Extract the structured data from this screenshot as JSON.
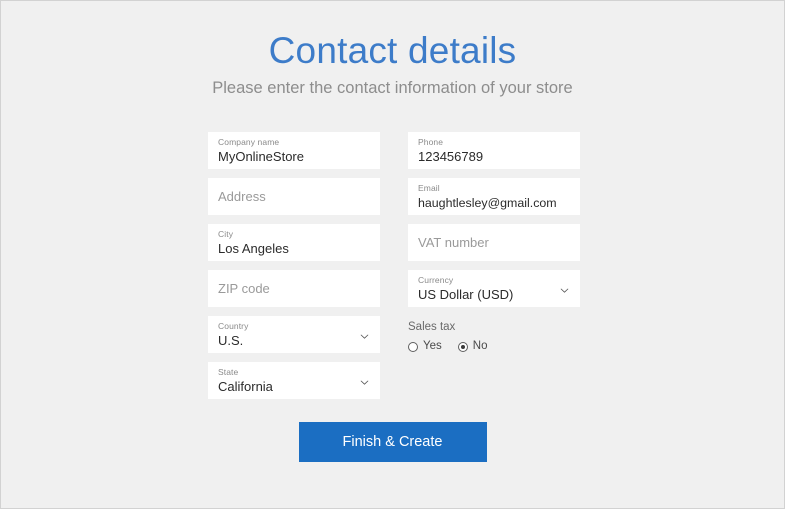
{
  "header": {
    "title": "Contact details",
    "subtitle": "Please enter the contact information of your store",
    "title_color": "#3d7cc9",
    "subtitle_color": "#8d8d8d"
  },
  "form": {
    "left_column": [
      {
        "name": "company-name",
        "label": "Company name",
        "value": "MyOnlineStore",
        "placeholder": "Company name",
        "state": "filled",
        "type": "text"
      },
      {
        "name": "address",
        "label": "Address",
        "value": "",
        "placeholder": "Address",
        "state": "empty",
        "type": "text"
      },
      {
        "name": "city",
        "label": "City",
        "value": "Los Angeles",
        "placeholder": "City",
        "state": "filled",
        "type": "text"
      },
      {
        "name": "zip-code",
        "label": "ZIP code",
        "value": "",
        "placeholder": "ZIP code",
        "state": "empty",
        "type": "text"
      },
      {
        "name": "country",
        "label": "Country",
        "value": "U.S.",
        "placeholder": "Country",
        "state": "filled",
        "type": "select"
      },
      {
        "name": "state",
        "label": "State",
        "value": "California",
        "placeholder": "State",
        "state": "filled",
        "type": "select"
      }
    ],
    "right_column": [
      {
        "name": "phone",
        "label": "Phone",
        "value": "123456789",
        "placeholder": "Phone",
        "state": "filled",
        "type": "text"
      },
      {
        "name": "email",
        "label": "Email",
        "value": "haughtlesley@gmail.com",
        "placeholder": "Email",
        "state": "filled",
        "type": "text"
      },
      {
        "name": "vat-number",
        "label": "VAT number",
        "value": "",
        "placeholder": "VAT number",
        "state": "empty",
        "type": "text"
      },
      {
        "name": "currency",
        "label": "Currency",
        "value": "US Dollar (USD)",
        "placeholder": "Currency",
        "state": "filled",
        "type": "select"
      }
    ],
    "sales_tax": {
      "label": "Sales tax",
      "options": [
        {
          "label": "Yes",
          "value": "yes",
          "selected": false
        },
        {
          "label": "No",
          "value": "no",
          "selected": true
        }
      ]
    }
  },
  "actions": {
    "submit_label": "Finish & Create",
    "submit_color": "#1b6ec2"
  },
  "icons": {
    "chevron_down": "chevron-down-icon"
  },
  "colors": {
    "background": "#f0f0f0",
    "field_background": "#ffffff",
    "border": "#d2d2d2",
    "label_text": "#8a8a8a",
    "value_text": "#2b2b2b",
    "placeholder_text": "#9a9a9a"
  }
}
